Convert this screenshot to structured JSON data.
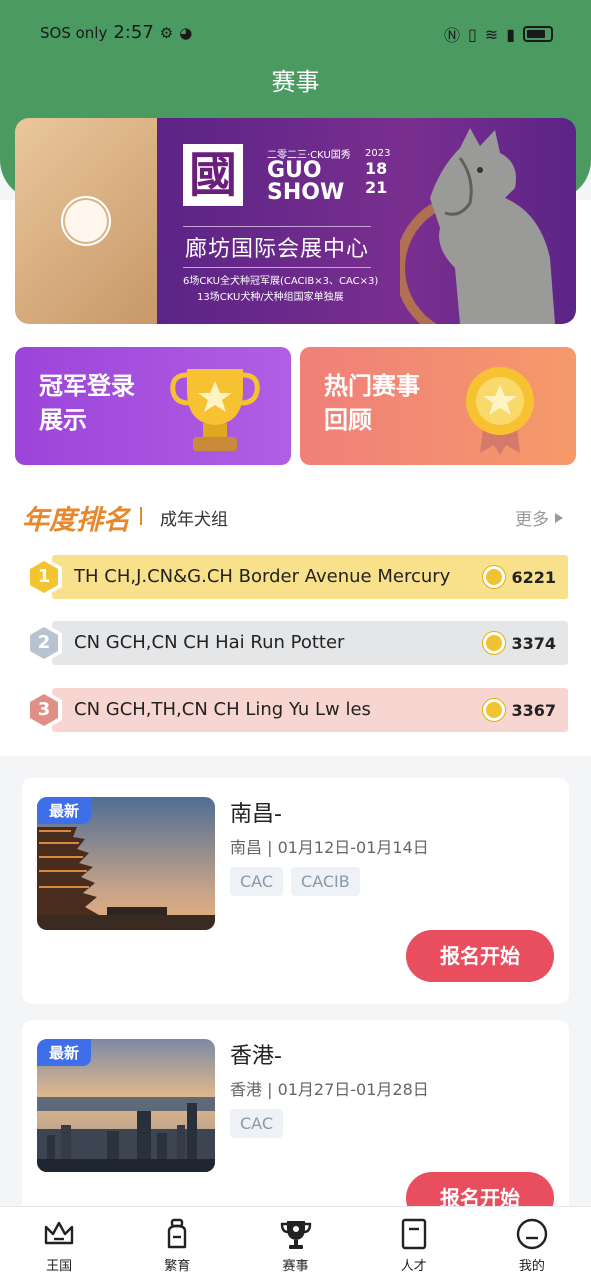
{
  "status_bar": {
    "carrier": "SOS only",
    "time": "2:57"
  },
  "header": {
    "title": "赛事"
  },
  "banner": {
    "guo_char": "國",
    "small_line": "二零二三·CKU国秀",
    "show_title": "GUO SHOW",
    "year": "2023",
    "date_top": "18",
    "date_bottom": "21",
    "venue": "廊坊国际会展中心",
    "line1": "6场CKU全犬种冠军展(CACIB×3、CAC×3)",
    "line2": "13场CKU犬种/犬种组国家单独展"
  },
  "promos": [
    {
      "label_line1": "冠军登录",
      "label_line2": "展示"
    },
    {
      "label_line1": "热门赛事",
      "label_line2": "回顾"
    }
  ],
  "ranking": {
    "title": "年度排名",
    "subtitle": "成年犬组",
    "more_label": "更多",
    "rows": [
      {
        "rank": "1",
        "name": "TH CH,J.CN&G.CH Border Avenue  Mercury",
        "score": "6221",
        "bar_color": "#f9e08a",
        "badge_color": "#f4c430"
      },
      {
        "rank": "2",
        "name": "CN GCH,CN CH Hai Run Potter",
        "score": "3374",
        "bar_color": "#e5e6e8",
        "badge_color": "#b9c3cf"
      },
      {
        "rank": "3",
        "name": "CN GCH,TH,CN CH Ling Yu  Lw les",
        "score": "3367",
        "bar_color": "#f7d6d2",
        "badge_color": "#df8f86"
      }
    ]
  },
  "events": [
    {
      "tag": "最新",
      "title": "南昌-",
      "meta": "南昌 | 01月12日-01月14日",
      "tags": [
        "CAC",
        "CACIB"
      ],
      "button": "报名开始"
    },
    {
      "tag": "最新",
      "title": "香港-",
      "meta": "香港 | 01月27日-01月28日",
      "tags": [
        "CAC"
      ],
      "button": "报名开始"
    }
  ],
  "tabbar": {
    "items": [
      {
        "label": "王国",
        "icon": "crown-icon"
      },
      {
        "label": "繁育",
        "icon": "bottle-icon"
      },
      {
        "label": "赛事",
        "icon": "trophy-icon"
      },
      {
        "label": "人才",
        "icon": "card-icon"
      },
      {
        "label": "我的",
        "icon": "profile-icon"
      }
    ]
  }
}
